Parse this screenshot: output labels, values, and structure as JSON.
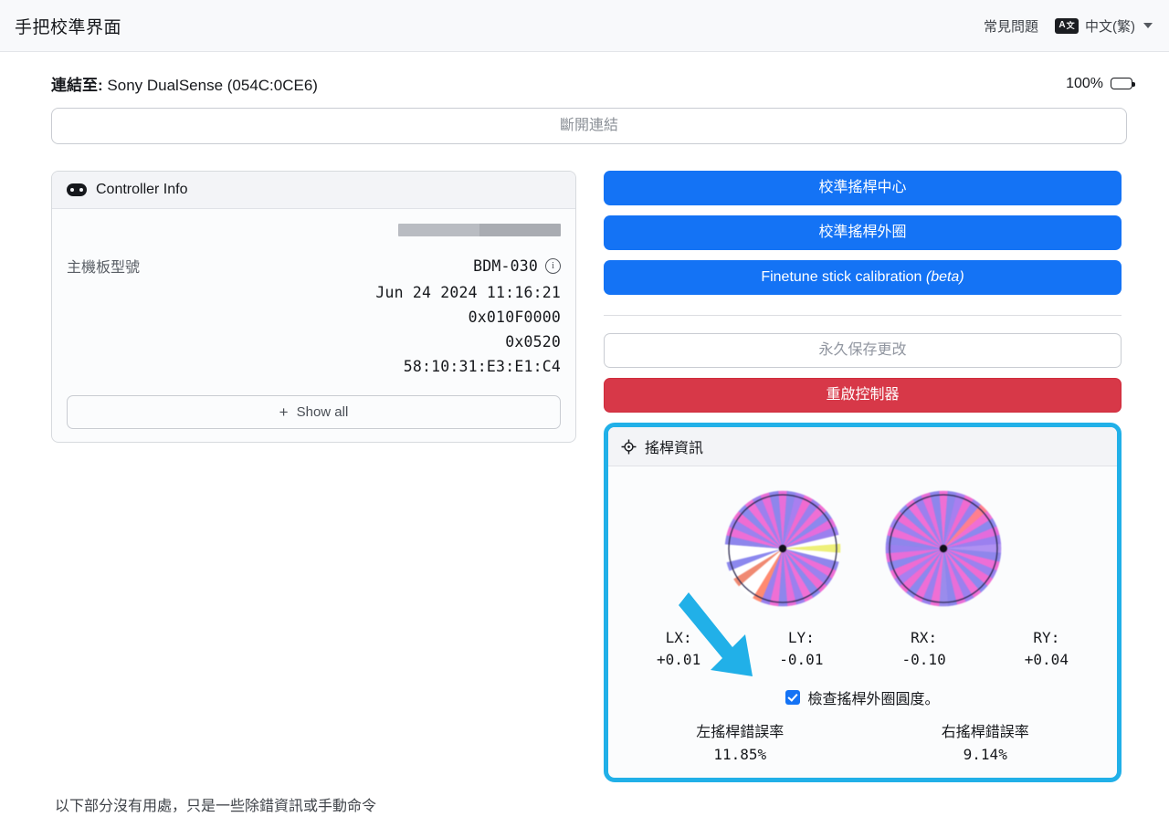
{
  "header": {
    "title": "手把校準界面",
    "faq_label": "常見問題",
    "language_label": "中文(繁)",
    "translate_icon_a": "A",
    "translate_icon_cjk": "文",
    "caret_icon": "chevron-down-icon"
  },
  "connection": {
    "prefix": "連結至:",
    "device": " Sony DualSense (054C:0CE6)",
    "battery_percent": "100%",
    "disconnect_label": "斷開連結"
  },
  "controller_info": {
    "card_title": "Controller Info",
    "board_model_label": "主機板型號",
    "board_model_value": "BDM-030",
    "build_date": "Jun 24 2024 11:16:21",
    "fw_address": "0x010F0000",
    "fw_version": "0x0520",
    "mac_address": "58:10:31:E3:E1:C4",
    "show_all_label": "Show all",
    "plus_glyph": "+"
  },
  "actions": {
    "calibrate_center": "校準搖桿中心",
    "calibrate_range": "校準搖桿外圈",
    "finetune_main": "Finetune stick calibration ",
    "finetune_beta": "(beta)",
    "save_permanent": "永久保存更改",
    "reboot_controller": "重啟控制器"
  },
  "stick_panel": {
    "title": "搖桿資訊",
    "title_icon": "crosshair-icon",
    "axes": [
      {
        "name": "LX:",
        "value": "+0.01"
      },
      {
        "name": "LY:",
        "value": "-0.01"
      },
      {
        "name": "RX:",
        "value": "-0.10"
      },
      {
        "name": "RY:",
        "value": "+0.04"
      }
    ],
    "checkbox_label": "檢查搖桿外圈圓度。",
    "checkbox_checked": true,
    "errors": [
      {
        "label": "左搖桿錯誤率",
        "value": "11.85%"
      },
      {
        "label": "右搖桿錯誤率",
        "value": "9.14%"
      }
    ]
  },
  "footnote": "以下部分沒有用處，只是一些除錯資訊或手動命令",
  "colors": {
    "accent_blue": "#1473f5",
    "danger_red": "#d73848",
    "highlight_cyan": "#21b0e8"
  },
  "chart_data": {
    "type": "radial",
    "description": "Two analog-stick range plots drawn as coloured radial wedges inside a circle outline with a black centre dot",
    "left_stick": {
      "label": "left-stick",
      "center_dot": true,
      "wedges": [
        {
          "angle": 0,
          "color": "#e86ed8"
        },
        {
          "angle": 9,
          "color": "#8e86ec"
        },
        {
          "angle": 18,
          "color": "#a87ff0"
        },
        {
          "angle": 27,
          "color": "#f06bd0"
        },
        {
          "angle": 36,
          "color": "#9a80ee"
        },
        {
          "angle": 45,
          "color": "#ef6fd4"
        },
        {
          "angle": 54,
          "color": "#8c88ee"
        },
        {
          "angle": 63,
          "color": "#e46cdc"
        },
        {
          "angle": 72,
          "color": "#9b80ef"
        },
        {
          "angle": 81,
          "color": "#ffffff"
        },
        {
          "angle": 90,
          "color": "#eef07a"
        },
        {
          "angle": 99,
          "color": "#ffffff"
        },
        {
          "angle": 108,
          "color": "#8f86ec"
        },
        {
          "angle": 117,
          "color": "#ee6ed6"
        },
        {
          "angle": 126,
          "color": "#9b82ef"
        },
        {
          "angle": 135,
          "color": "#ef6cd2"
        },
        {
          "angle": 144,
          "color": "#8b89ee"
        },
        {
          "angle": 153,
          "color": "#f070d6"
        },
        {
          "angle": 162,
          "color": "#9c80ee"
        },
        {
          "angle": 171,
          "color": "#e86ed8"
        },
        {
          "angle": 180,
          "color": "#8e86ec"
        },
        {
          "angle": 189,
          "color": "#ef6fd4"
        },
        {
          "angle": 198,
          "color": "#9a80ee"
        },
        {
          "angle": 207,
          "color": "#ff8a70"
        },
        {
          "angle": 216,
          "color": "#ffffff"
        },
        {
          "angle": 225,
          "color": "#ffffff"
        },
        {
          "angle": 234,
          "color": "#f08a72"
        },
        {
          "angle": 243,
          "color": "#ffffff"
        },
        {
          "angle": 252,
          "color": "#8c88ee"
        },
        {
          "angle": 261,
          "color": "#ffffff"
        },
        {
          "angle": 270,
          "color": "#ffffff"
        },
        {
          "angle": 279,
          "color": "#8e86ec"
        },
        {
          "angle": 288,
          "color": "#ee6ed6"
        },
        {
          "angle": 297,
          "color": "#9b82ef"
        },
        {
          "angle": 306,
          "color": "#ef6cd2"
        },
        {
          "angle": 315,
          "color": "#8b89ee"
        },
        {
          "angle": 324,
          "color": "#f070d6"
        },
        {
          "angle": 333,
          "color": "#9c80ee"
        },
        {
          "angle": 342,
          "color": "#e86ed8"
        },
        {
          "angle": 351,
          "color": "#8e86ec"
        }
      ]
    },
    "right_stick": {
      "label": "right-stick",
      "center_dot": true,
      "wedges": [
        {
          "angle": 0,
          "color": "#ef6fd4"
        },
        {
          "angle": 9,
          "color": "#8e86ec"
        },
        {
          "angle": 18,
          "color": "#a87ff0"
        },
        {
          "angle": 27,
          "color": "#f06bd0"
        },
        {
          "angle": 36,
          "color": "#9a80ee"
        },
        {
          "angle": 45,
          "color": "#ff7f8f"
        },
        {
          "angle": 54,
          "color": "#ef6fd4"
        },
        {
          "angle": 63,
          "color": "#8c88ee"
        },
        {
          "angle": 72,
          "color": "#e46cdc"
        },
        {
          "angle": 81,
          "color": "#9b80ef"
        },
        {
          "angle": 90,
          "color": "#b091f2"
        },
        {
          "angle": 99,
          "color": "#8f86ec"
        },
        {
          "angle": 108,
          "color": "#ee6ed6"
        },
        {
          "angle": 117,
          "color": "#9b82ef"
        },
        {
          "angle": 126,
          "color": "#ef6cd2"
        },
        {
          "angle": 135,
          "color": "#8b89ee"
        },
        {
          "angle": 144,
          "color": "#f070d6"
        },
        {
          "angle": 153,
          "color": "#9c80ee"
        },
        {
          "angle": 162,
          "color": "#e86ed8"
        },
        {
          "angle": 171,
          "color": "#8e86ec"
        },
        {
          "angle": 180,
          "color": "#9a8cec"
        },
        {
          "angle": 189,
          "color": "#ef6fd4"
        },
        {
          "angle": 198,
          "color": "#9a80ee"
        },
        {
          "angle": 207,
          "color": "#ee6ed6"
        },
        {
          "angle": 216,
          "color": "#8c88ee"
        },
        {
          "angle": 225,
          "color": "#f06bd0"
        },
        {
          "angle": 234,
          "color": "#a87ff0"
        },
        {
          "angle": 243,
          "color": "#ef6cd2"
        },
        {
          "angle": 252,
          "color": "#8c88ee"
        },
        {
          "angle": 261,
          "color": "#e86ed8"
        },
        {
          "angle": 270,
          "color": "#9b80ef"
        },
        {
          "angle": 279,
          "color": "#8e86ec"
        },
        {
          "angle": 288,
          "color": "#ee6ed6"
        },
        {
          "angle": 297,
          "color": "#9b82ef"
        },
        {
          "angle": 306,
          "color": "#ef6cd2"
        },
        {
          "angle": 315,
          "color": "#8b89ee"
        },
        {
          "angle": 324,
          "color": "#f070d6"
        },
        {
          "angle": 333,
          "color": "#9c80ee"
        },
        {
          "angle": 342,
          "color": "#e86ed8"
        },
        {
          "angle": 351,
          "color": "#8e86ec"
        }
      ]
    }
  }
}
